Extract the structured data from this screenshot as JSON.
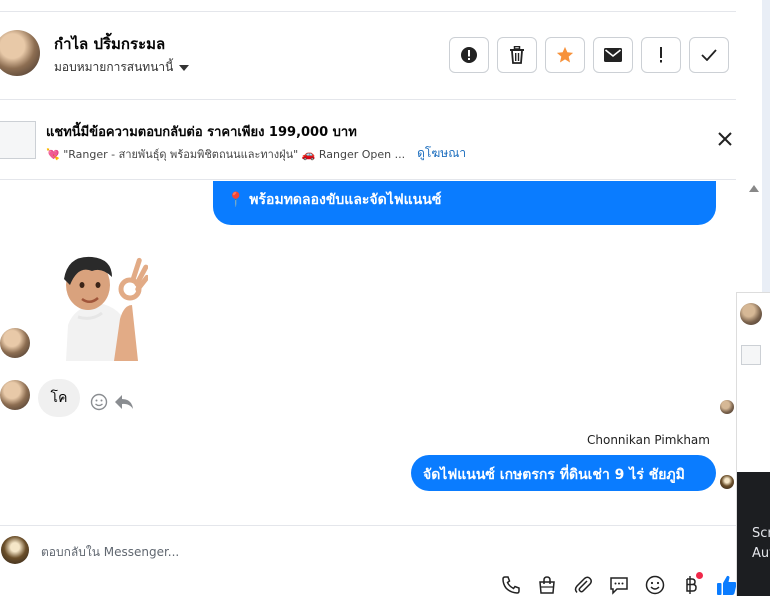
{
  "header": {
    "contact_name": "กำไล ปริ้มกระมล",
    "assign_label": "มอบหมายการสนทนานี้",
    "actions": [
      "mark-spam-icon",
      "trash-icon",
      "star-icon",
      "mail-icon",
      "important-icon",
      "check-icon"
    ]
  },
  "ad": {
    "title": "แชทนี้มีข้อความตอบกลับต่อ ราคาเพียง 199,000 บาท",
    "subtitle": "💘 \"Ranger - สายพันธุ์ดุ พร้อมพิชิตถนนและทางฝุ่น\" 🚗 Ranger Open ...",
    "link": "ดูโฆษณา"
  },
  "messages": {
    "outgoing_top": "📍 พร้อมทดลองขับและจัดไฟแนนซ์",
    "incoming_text": "โค",
    "sender_name": "Chonnikan Pimkham",
    "outgoing_bottom": "จัดไฟแนนซ์ เกษตรกร ที่ดินเช่า 9 ไร่  ชัยภูมิ"
  },
  "composer": {
    "placeholder": "ตอบกลับใน Messenger..."
  },
  "side_panel": {
    "dark_text_1": "Scr",
    "dark_text_2": "Aut"
  },
  "colors": {
    "accent": "#0a7cff",
    "star": "#f7923b",
    "link": "#1e6fbf"
  }
}
